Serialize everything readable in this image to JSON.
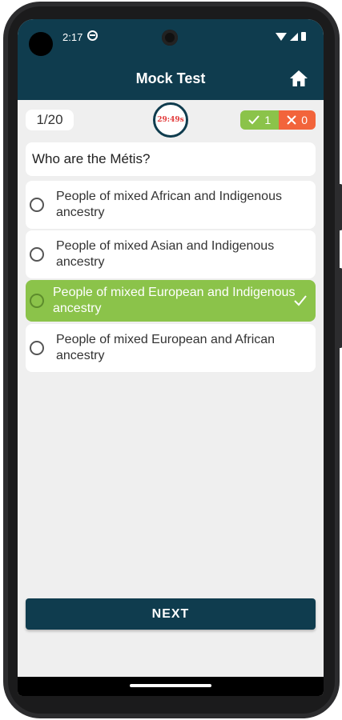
{
  "status_bar": {
    "time": "2:17"
  },
  "app_bar": {
    "title": "Mock Test",
    "home_icon": "home-icon"
  },
  "progress": {
    "counter": "1/20",
    "timer": "29:49s",
    "correct": "1",
    "wrong": "0"
  },
  "question": {
    "text": "Who are the Métis?"
  },
  "options": [
    {
      "label": "People of mixed African and Indigenous ancestry",
      "selected": false
    },
    {
      "label": "People of mixed Asian and Indigenous ancestry",
      "selected": false
    },
    {
      "label": "People of mixed European and Indigenous ancestry",
      "selected": true
    },
    {
      "label": "People of mixed European and African ancestry",
      "selected": false
    }
  ],
  "actions": {
    "next_label": "NEXT"
  },
  "colors": {
    "header": "#0f3c4e",
    "correct": "#8bc34a",
    "wrong": "#f2643b",
    "timer_text": "#e23b3b"
  }
}
